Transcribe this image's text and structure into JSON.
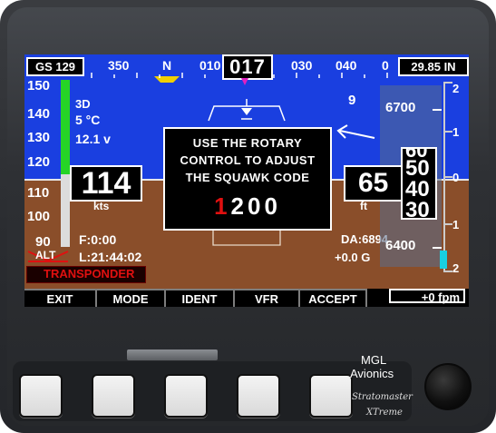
{
  "heading_tape": {
    "gs": "GS 129",
    "labels": [
      "350",
      "N",
      "010",
      "030",
      "040",
      "0"
    ],
    "current": "017",
    "baro": "29.85 IN"
  },
  "airspeed": {
    "ticks": [
      "150",
      "140",
      "130",
      "120",
      "110",
      "100",
      "90"
    ],
    "value": "114",
    "unit": "kts"
  },
  "info": {
    "fix": "3D",
    "temp": "5 °C",
    "volts": "12.1 v"
  },
  "altitude": {
    "ticks": [
      "6700",
      "6400"
    ],
    "scale": [
      "2",
      "1",
      "0",
      "1",
      "2"
    ],
    "value_big": "65",
    "rolls": [
      "50",
      "40",
      "30"
    ],
    "roll_partial_top": "60",
    "unit": "ft",
    "da": "DA:6894",
    "gforce": "+0.0 G",
    "vs": "+0 fpm"
  },
  "flight": {
    "flight_time": "F:0:00",
    "local_time": "L:21:44:02",
    "alt_label": "ALT",
    "transponder_label": "TRANSPONDER"
  },
  "roll_number": "9",
  "dialog": {
    "line1": "USE THE ROTARY",
    "line2": "CONTROL TO ADJUST",
    "line3": "THE SQUAWK CODE",
    "code_first": "1",
    "code_rest": "200"
  },
  "softkeys": [
    "EXIT",
    "MODE",
    "IDENT",
    "VFR",
    "ACCEPT"
  ],
  "bezel": {
    "brand1": "MGL",
    "brand2": "Avionics",
    "model1": "Stratomaster",
    "model2": "XTreme"
  },
  "colors": {
    "sky": "#1a3fe0",
    "ground": "#8a4e2a",
    "accent_red": "#e01010",
    "accent_green": "#26d426",
    "accent_cyan": "#18d0e0",
    "accent_magenta": "#e020c0",
    "accent_yellow": "#f0d000"
  }
}
